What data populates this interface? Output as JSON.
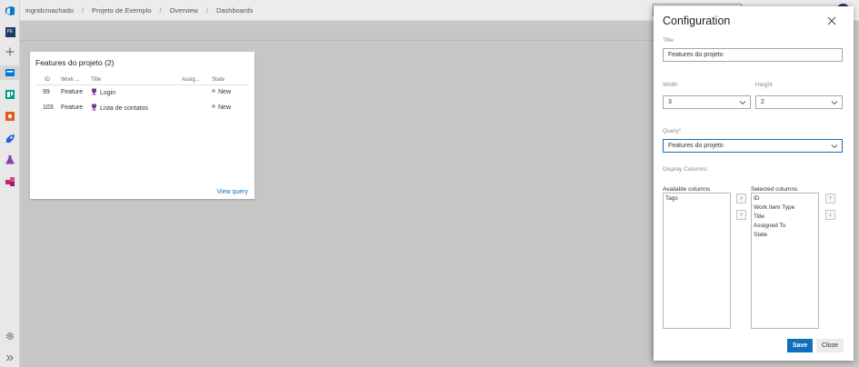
{
  "breadcrumb": [
    "ingridcmachado",
    "Projeto de Exemplo",
    "Overview",
    "Dashboards"
  ],
  "breadcrumb_separator": "/",
  "leftnav": {
    "project_initials": "PE",
    "items": [
      "azure-devops-icon",
      "project-icon",
      "plus-icon",
      "overview-icon",
      "boards-icon",
      "repos-icon",
      "pipelines-icon",
      "test-plans-icon",
      "artifacts-icon",
      "gear-icon",
      "expand-icon"
    ]
  },
  "widget": {
    "title": "Features do projeto (2)",
    "columns": [
      "ID",
      "Work ...",
      "Title",
      "Assig...",
      "State"
    ],
    "rows": [
      {
        "id": "99",
        "type": "Feature",
        "title": "Login",
        "assigned": "",
        "state": "New"
      },
      {
        "id": "103",
        "type": "Feature",
        "title": "Lista de contatos",
        "assigned": "",
        "state": "New"
      }
    ],
    "view_query": "View query"
  },
  "config": {
    "heading": "Configuration",
    "title_label": "Title",
    "title_value": "Features do projeto",
    "width_label": "Width",
    "width_value": "3",
    "height_label": "Height",
    "height_value": "2",
    "query_label": "Query*",
    "query_value": "Features do projeto",
    "display_columns_label": "Display Columns",
    "available_label": "Available columns",
    "available": [
      "Tags"
    ],
    "selected_label": "Selected columns",
    "selected": [
      "ID",
      "Work Item Type",
      "Title",
      "Assigned To",
      "State"
    ],
    "move_right": "›",
    "move_left": "‹",
    "move_up": "↑",
    "move_down": "↓",
    "save": "Save",
    "close": "Close"
  },
  "colors": {
    "accent": "#106ebe",
    "state_new": "#b2b2b2",
    "feature_icon": "#773b93"
  }
}
